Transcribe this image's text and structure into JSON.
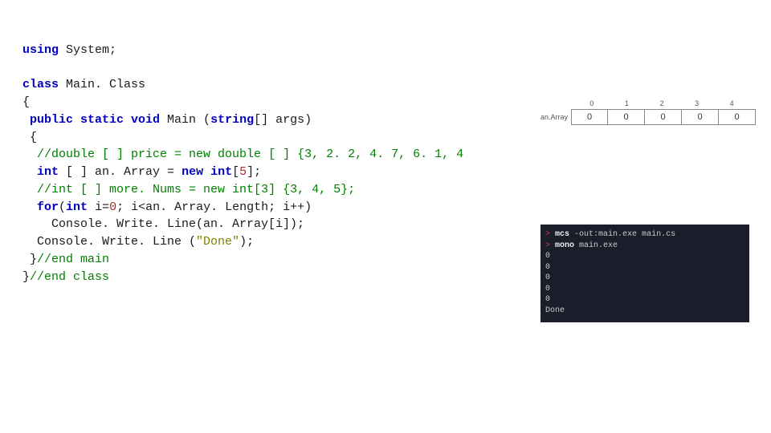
{
  "code": {
    "line1_kw1": "using",
    "line1_rest": " System;",
    "blank1": "",
    "line2_kw1": "class",
    "line2_rest": " Main. Class",
    "line3": "{",
    "line4_pre": " ",
    "line4_kw1": "public static void",
    "line4_rest": " Main (",
    "line4_kw2": "string",
    "line4_rest2": "[] args)",
    "line5": " {",
    "line6_pre": "  ",
    "line6_comment": "//double [ ] price = new double [ ] {3, 2. 2, 4. 7, 6. 1, 4 ",
    "line7_pre": "  ",
    "line7_kw1": "int",
    "line7_mid": " [ ] an. Array = ",
    "line7_kw2": "new int",
    "line7_mid2": "[",
    "line7_num": "5",
    "line7_end": "];",
    "line8_pre": "  ",
    "line8_comment": "//int [ ] more. Nums = new int[3] {3, 4, 5};",
    "line9_pre": "  ",
    "line9_kw1": "for",
    "line9_mid": "(",
    "line9_kw2": "int",
    "line9_mid2": " i=",
    "line9_num0": "0",
    "line9_rest": "; i<an. Array. Length; i++)",
    "line10": "    Console. Write. Line(an. Array[i]);",
    "line11_pre": "  Console. Write. Line (",
    "line11_str": "\"Done\"",
    "line11_end": ");",
    "line12_pre": " }",
    "line12_comment": "//end main",
    "line13_pre": "}",
    "line13_comment": "//end class"
  },
  "array": {
    "label": "an.Array",
    "indices": [
      "0",
      "1",
      "2",
      "3",
      "4"
    ],
    "values": [
      "0",
      "0",
      "0",
      "0",
      "0"
    ]
  },
  "terminal": {
    "prompt": ">",
    "cmd1_head": "mcs",
    "cmd1_rest": " -out:main.exe main.cs",
    "cmd2_head": "mono",
    "cmd2_rest": " main.exe",
    "out": [
      "0",
      "0",
      "0",
      "0",
      "0",
      "Done"
    ]
  }
}
